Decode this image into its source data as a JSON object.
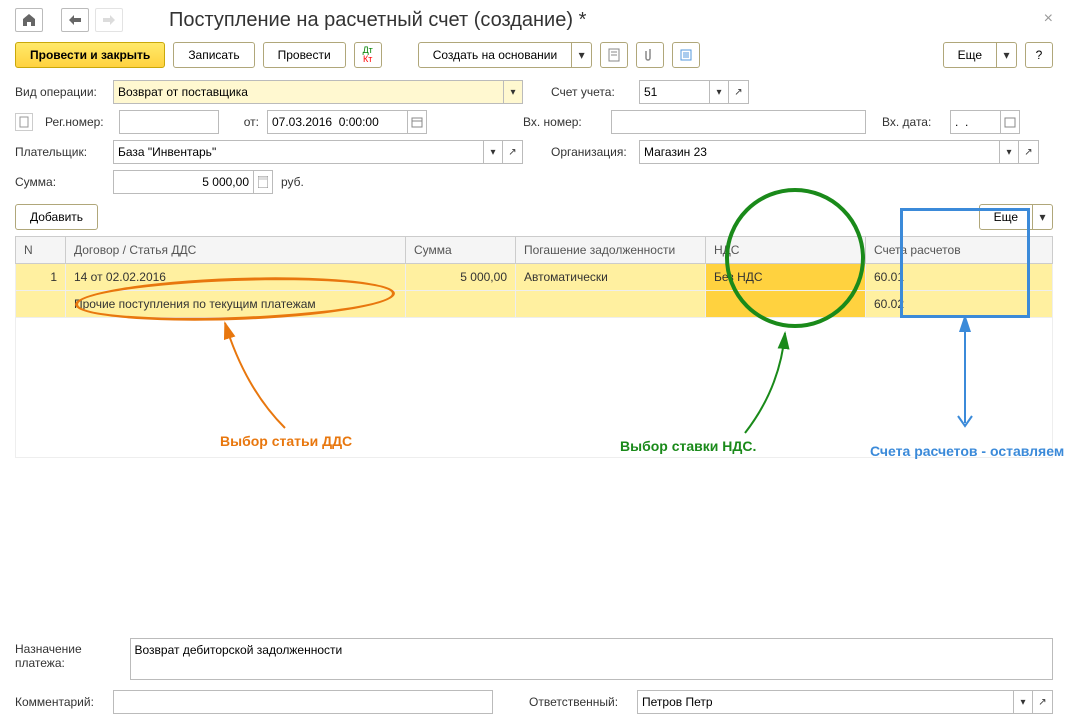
{
  "header": {
    "title": "Поступление на расчетный счет (создание) *"
  },
  "toolbar": {
    "post_close": "Провести и закрыть",
    "save": "Записать",
    "post": "Провести",
    "create_based": "Создать на основании",
    "more1": "Еще",
    "more2": "Еще"
  },
  "fields": {
    "operation_type_label": "Вид операции:",
    "operation_type": "Возврат от поставщика",
    "account_label": "Счет учета:",
    "account": "51",
    "reg_num_label": "Рег.номер:",
    "reg_num": "",
    "date_from_label": "от:",
    "date_from": "07.03.2016  0:00:00",
    "in_num_label": "Вх. номер:",
    "in_num": "",
    "in_date_label": "Вх. дата:",
    "in_date": ".  .",
    "payer_label": "Плательщик:",
    "payer": "База \"Инвентарь\"",
    "org_label": "Организация:",
    "org": "Магазин 23",
    "sum_label": "Сумма:",
    "sum": "5 000,00",
    "currency": "руб.",
    "add_btn": "Добавить",
    "purpose_label": "Назначение платежа:",
    "purpose": "Возврат дебиторской задолженности",
    "comment_label": "Комментарий:",
    "comment": "",
    "responsible_label": "Ответственный:",
    "responsible": "Петров Петр"
  },
  "table": {
    "headers": {
      "n": "N",
      "contract": "Договор / Статья ДДС",
      "sum": "Сумма",
      "debt": "Погашение задолженности",
      "vat": "НДС",
      "accounts": "Счета расчетов"
    },
    "rows": [
      {
        "n": "1",
        "contract1": "14 от 02.02.2016",
        "contract2": "Прочие поступления по текущим платежам",
        "sum": "5 000,00",
        "debt": "Автоматически",
        "vat": "Без НДС",
        "acc1": "60.01",
        "acc2": "60.02"
      }
    ]
  },
  "annotations": {
    "dds": "Выбор статьи ДДС",
    "vat": "Выбор ставки НДС.",
    "accounts": "Счета расчетов - оставляем"
  }
}
